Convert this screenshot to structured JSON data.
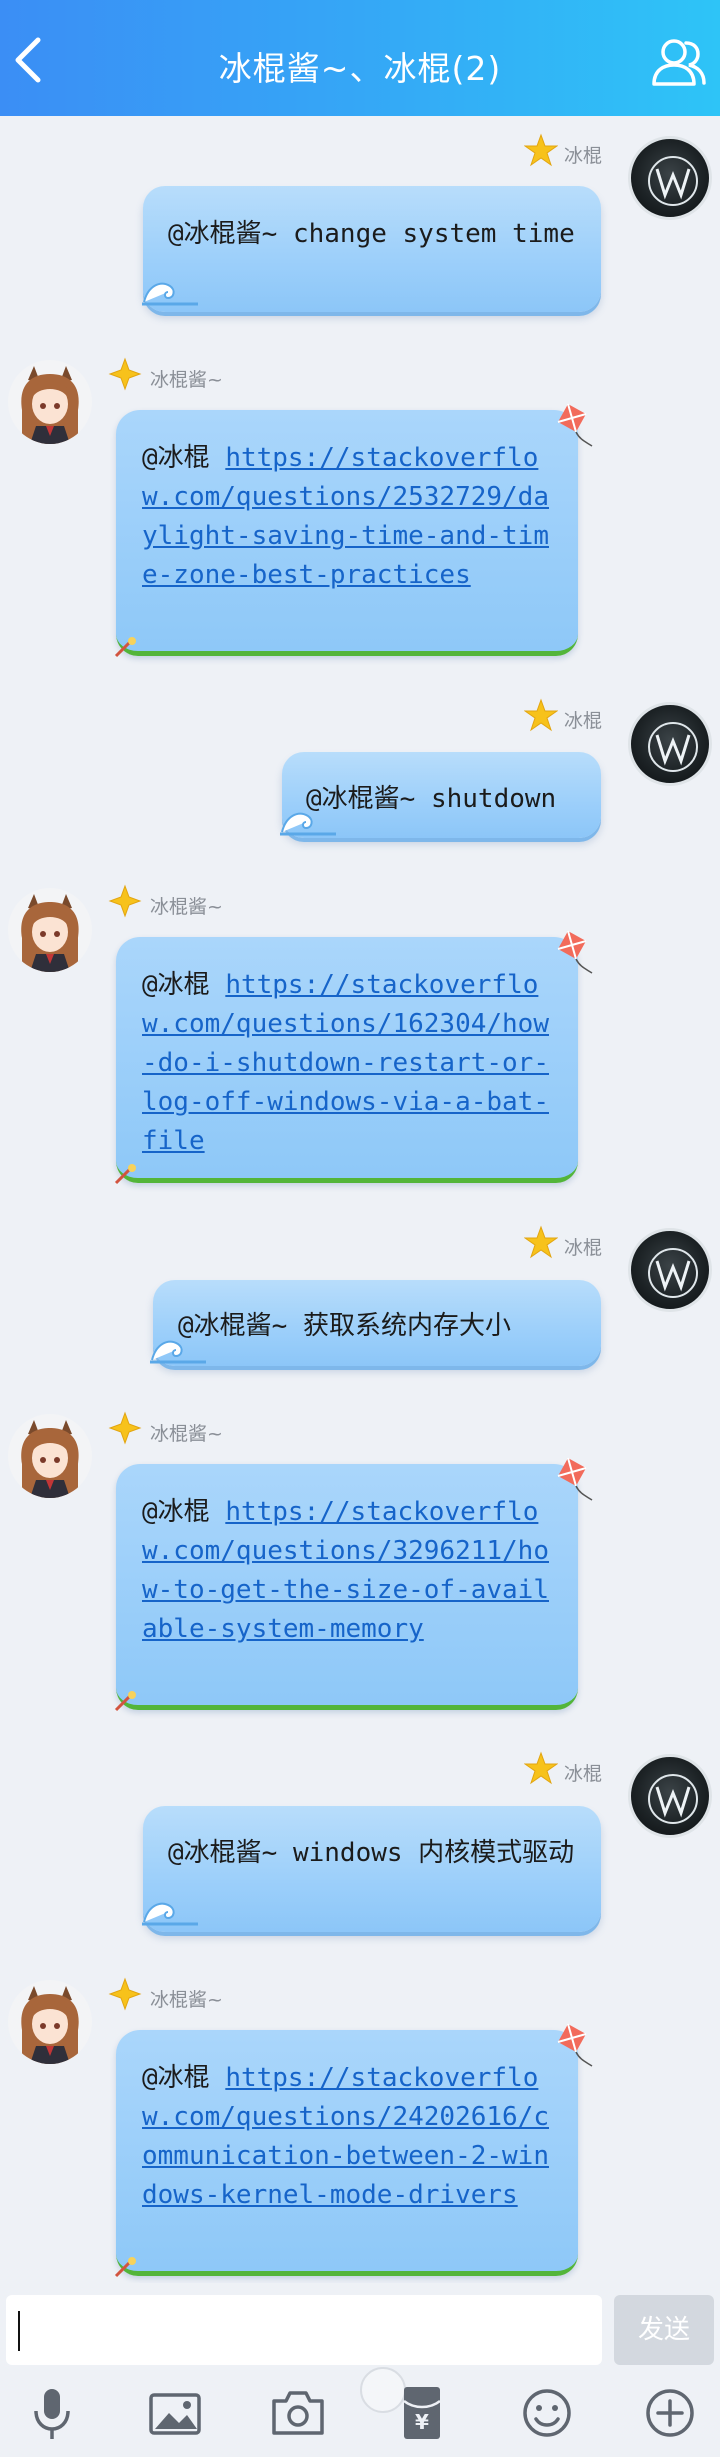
{
  "header": {
    "title": "冰棍酱~、冰棍(2)",
    "back_icon": "chevron-left-icon",
    "members_icon": "group-members-icon"
  },
  "messages": [
    {
      "side": "right",
      "nick": "冰棍",
      "text": "@冰棍酱~ change system time"
    },
    {
      "side": "left",
      "nick": "冰棍酱~",
      "mention": "@冰棍",
      "link": "https://stackoverflow.com/questions/2532729/daylight-saving-time-and-time-zone-best-practices"
    },
    {
      "side": "right",
      "nick": "冰棍",
      "text": "@冰棍酱~ shutdown"
    },
    {
      "side": "left",
      "nick": "冰棍酱~",
      "mention": "@冰棍",
      "link": "https://stackoverflow.com/questions/162304/how-do-i-shutdown-restart-or-log-off-windows-via-a-bat-file"
    },
    {
      "side": "right",
      "nick": "冰棍",
      "text": "@冰棍酱~ 获取系统内存大小"
    },
    {
      "side": "left",
      "nick": "冰棍酱~",
      "mention": "@冰棍",
      "link": "https://stackoverflow.com/questions/3296211/how-to-get-the-size-of-available-system-memory"
    },
    {
      "side": "right",
      "nick": "冰棍",
      "text": "@冰棍酱~ windows 内核模式驱动"
    },
    {
      "side": "left",
      "nick": "冰棍酱~",
      "mention": "@冰棍",
      "link": "https://stackoverflow.com/questions/24202616/communication-between-2-windows-kernel-mode-drivers"
    }
  ],
  "composer": {
    "send_label": "发送",
    "tools": [
      "microphone-icon",
      "image-icon",
      "camera-icon",
      "red-packet-icon",
      "emoji-icon",
      "plus-icon"
    ]
  }
}
